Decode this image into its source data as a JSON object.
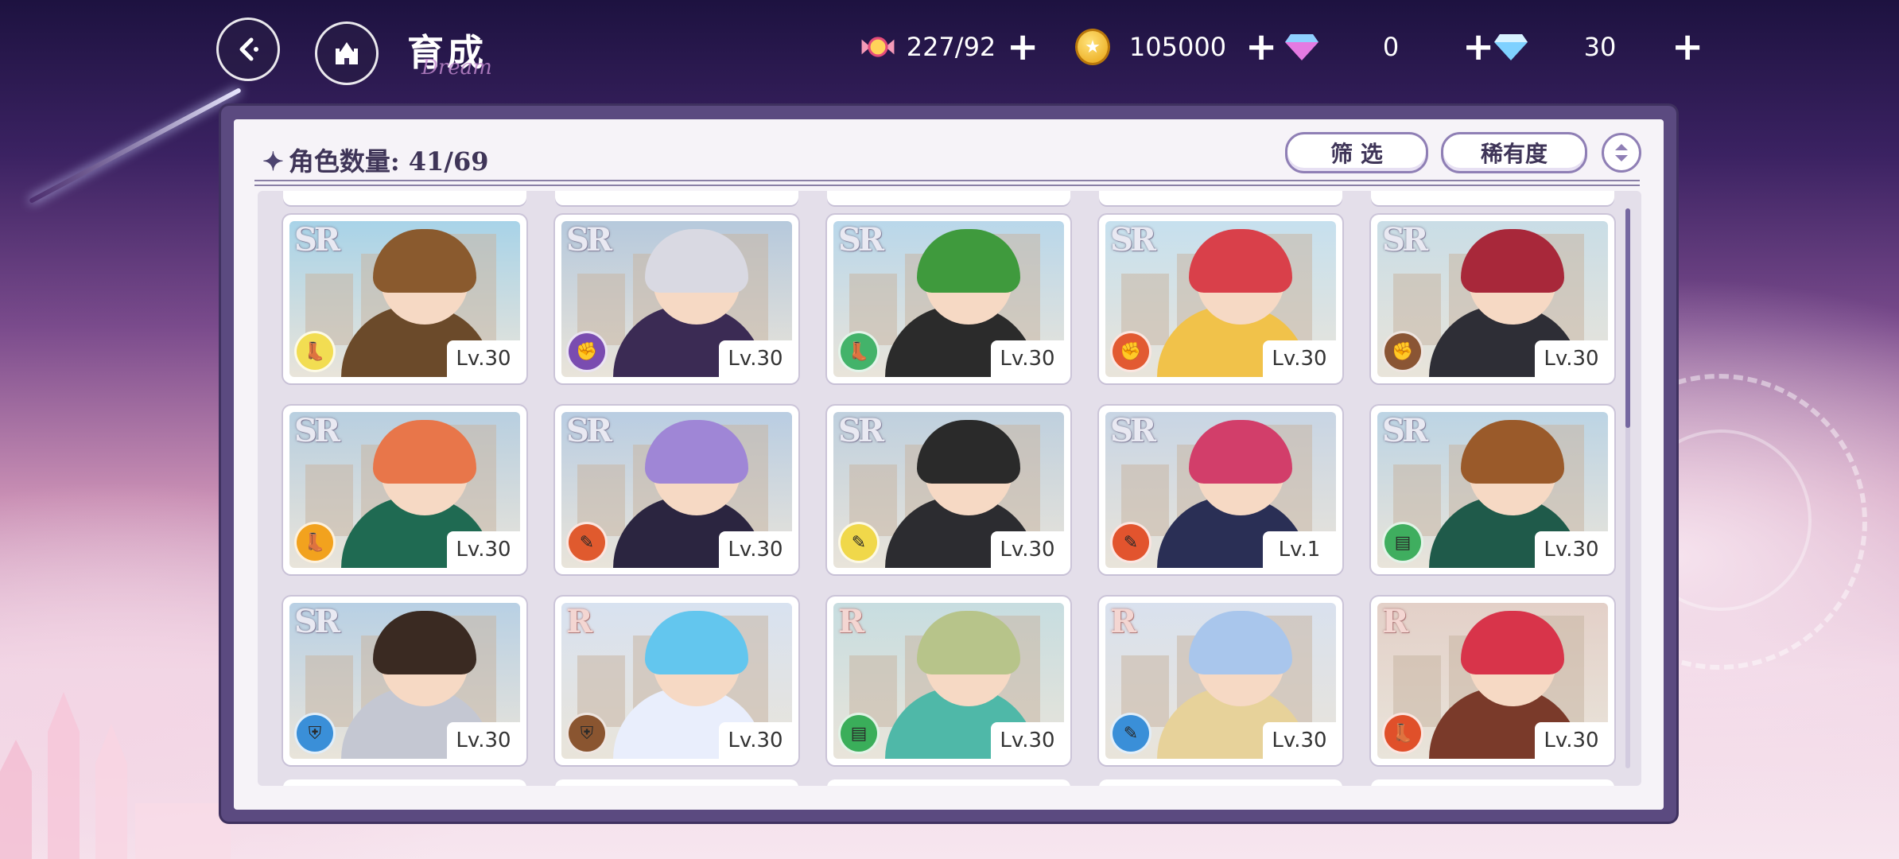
{
  "topbar": {
    "back_icon": "back-arrow-icon",
    "home_icon": "castle-icon",
    "title": "育成",
    "title_deco": "Dream",
    "resources": [
      {
        "name": "candy",
        "icon": "candy-icon",
        "value": "227/92"
      },
      {
        "name": "gold",
        "icon": "coin-icon",
        "value": "105000"
      },
      {
        "name": "gem",
        "icon": "gem-icon",
        "value": "0"
      },
      {
        "name": "diamond",
        "icon": "diamond-icon",
        "value": "30"
      }
    ]
  },
  "panel": {
    "count_label": "角色数量: 41/69",
    "filter_label": "筛 选",
    "rarity_label": "稀有度"
  },
  "colors": {
    "panel_border": "#5b4a80",
    "accent": "#8f7fb5",
    "text_dark": "#3f3558"
  },
  "cards": [
    {
      "rarity": "SR",
      "level": "Lv.30",
      "element": "boot-icon",
      "element_color": "#f2dd52",
      "hair": "#8a5a2e",
      "outfit": "#6b4a2a",
      "bg": "#a8d3e8"
    },
    {
      "rarity": "SR",
      "level": "Lv.30",
      "element": "fist-icon",
      "element_color": "#7a4cb0",
      "hair": "#d9d9e2",
      "outfit": "#3b2b54",
      "bg": "#b6c9dc"
    },
    {
      "rarity": "SR",
      "level": "Lv.30",
      "element": "boot-icon",
      "element_color": "#43b36a",
      "hair": "#3f9a3d",
      "outfit": "#2b2b2b",
      "bg": "#b9d7ea"
    },
    {
      "rarity": "SR",
      "level": "Lv.30",
      "element": "fist-icon",
      "element_color": "#e25a32",
      "hair": "#d9404a",
      "outfit": "#f1c24a",
      "bg": "#c6e0ee"
    },
    {
      "rarity": "SR",
      "level": "Lv.30",
      "element": "fist-icon",
      "element_color": "#8a5534",
      "hair": "#a8283a",
      "outfit": "#2e2e36",
      "bg": "#c9dde6"
    },
    {
      "rarity": "SR",
      "level": "Lv.30",
      "element": "boot-icon",
      "element_color": "#f2a21e",
      "hair": "#e8764a",
      "outfit": "#1f6a52",
      "bg": "#b8cfe0"
    },
    {
      "rarity": "SR",
      "level": "Lv.30",
      "element": "wand-icon",
      "element_color": "#e05a2e",
      "hair": "#9f86d6",
      "outfit": "#2b2540",
      "bg": "#b9cde2"
    },
    {
      "rarity": "SR",
      "level": "Lv.30",
      "element": "wand-icon",
      "element_color": "#f0d84a",
      "hair": "#2a2a2a",
      "outfit": "#2c2c30",
      "bg": "#bfd0de"
    },
    {
      "rarity": "SR",
      "level": "Lv.1",
      "element": "wand-icon",
      "element_color": "#e2542e",
      "hair": "#d23e6a",
      "outfit": "#2a2f55",
      "bg": "#c8d5e4"
    },
    {
      "rarity": "SR",
      "level": "Lv.30",
      "element": "card-icon",
      "element_color": "#3fae5f",
      "hair": "#9a5a2a",
      "outfit": "#1f5a4a",
      "bg": "#bcd4e4"
    },
    {
      "rarity": "SR",
      "level": "Lv.30",
      "element": "shield-icon",
      "element_color": "#3a8fd8",
      "hair": "#3a2a22",
      "outfit": "#c4c7d2",
      "bg": "#b8d0e4"
    },
    {
      "rarity": "R",
      "level": "Lv.30",
      "element": "shield-icon",
      "element_color": "#8a5530",
      "hair": "#63c6ee",
      "outfit": "#e9eefc",
      "bg": "#d8e2f0"
    },
    {
      "rarity": "R",
      "level": "Lv.30",
      "element": "card-icon",
      "element_color": "#3aae5a",
      "hair": "#b7c48a",
      "outfit": "#4fb8a8",
      "bg": "#c7dde0"
    },
    {
      "rarity": "R",
      "level": "Lv.30",
      "element": "wand-icon",
      "element_color": "#3a8fd8",
      "hair": "#a9c6ec",
      "outfit": "#e7d29a",
      "bg": "#d9e1ee"
    },
    {
      "rarity": "R",
      "level": "Lv.30",
      "element": "boot-icon",
      "element_color": "#e0502a",
      "hair": "#d8344a",
      "outfit": "#7a3a2a",
      "bg": "#e3d0c8"
    }
  ]
}
